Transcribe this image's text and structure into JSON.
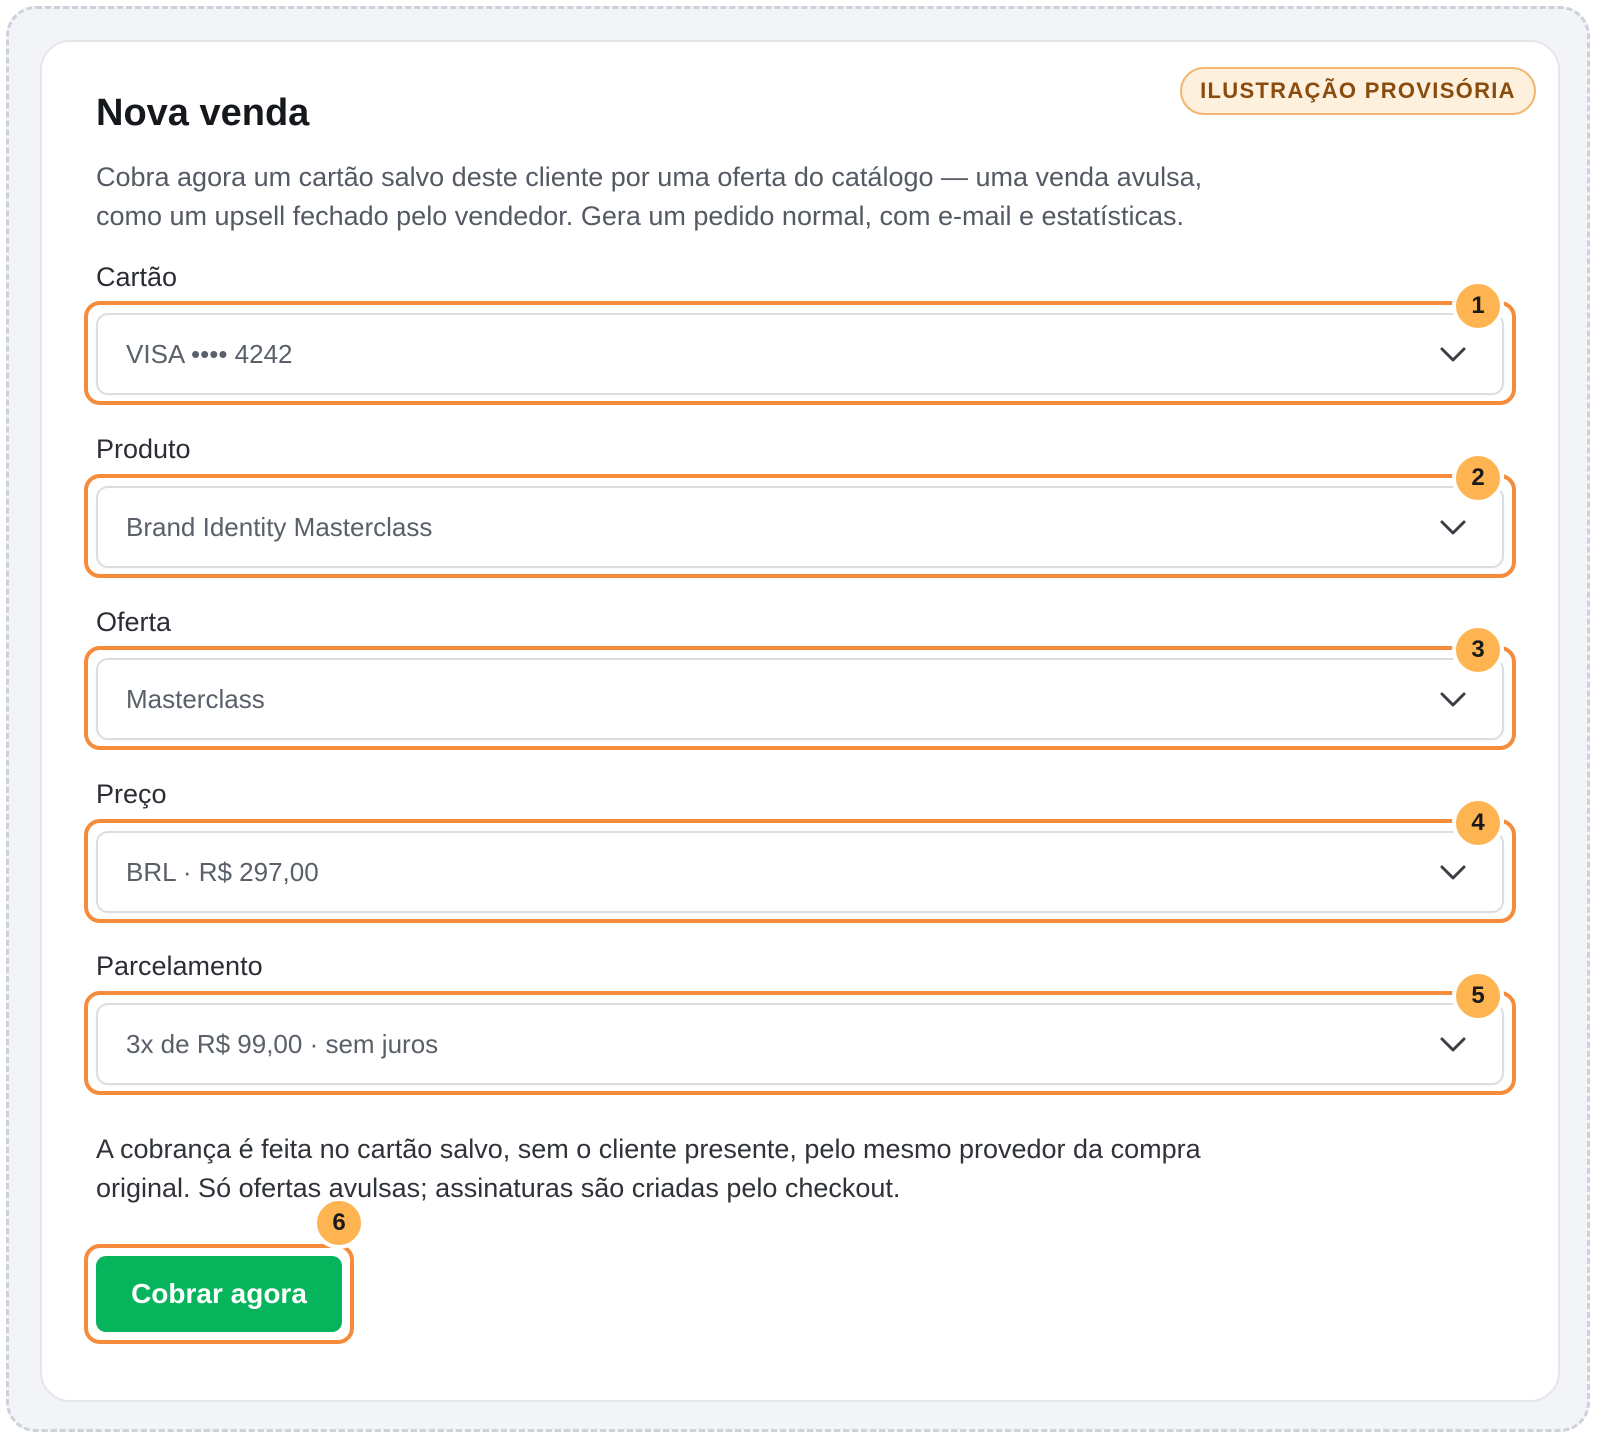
{
  "badge": "ILUSTRAÇÃO PROVISÓRIA",
  "title": "Nova venda",
  "intro": "Cobra agora um cartão salvo deste cliente por uma oferta do catálogo — uma venda avulsa, como um upsell fechado pelo vendedor. Gera um pedido normal, com e-mail e estatísticas.",
  "fields": [
    {
      "label": "Cartão",
      "value": "VISA •••• 4242",
      "marker": "1"
    },
    {
      "label": "Produto",
      "value": "Brand Identity Masterclass",
      "marker": "2"
    },
    {
      "label": "Oferta",
      "value": "Masterclass",
      "marker": "3"
    },
    {
      "label": "Preço",
      "value": "BRL · R$ 297,00",
      "marker": "4"
    },
    {
      "label": "Parcelamento",
      "value": "3x de R$ 99,00 · sem juros",
      "marker": "5"
    }
  ],
  "note": "A cobrança é feita no cartão salvo, sem o cliente presente, pelo mesmo provedor da compra original. Só ofertas avulsas; assinaturas são criadas pelo checkout.",
  "submit": {
    "label": "Cobrar agora",
    "marker": "6"
  },
  "icons": {
    "dropdown": "chevron-down-icon"
  },
  "colors": {
    "accent_highlight": "#f58c3c",
    "marker": "#fdb451",
    "primary_button": "#06b45c",
    "badge_text": "#8a4b0c",
    "badge_bg": "#fdf0dc"
  }
}
